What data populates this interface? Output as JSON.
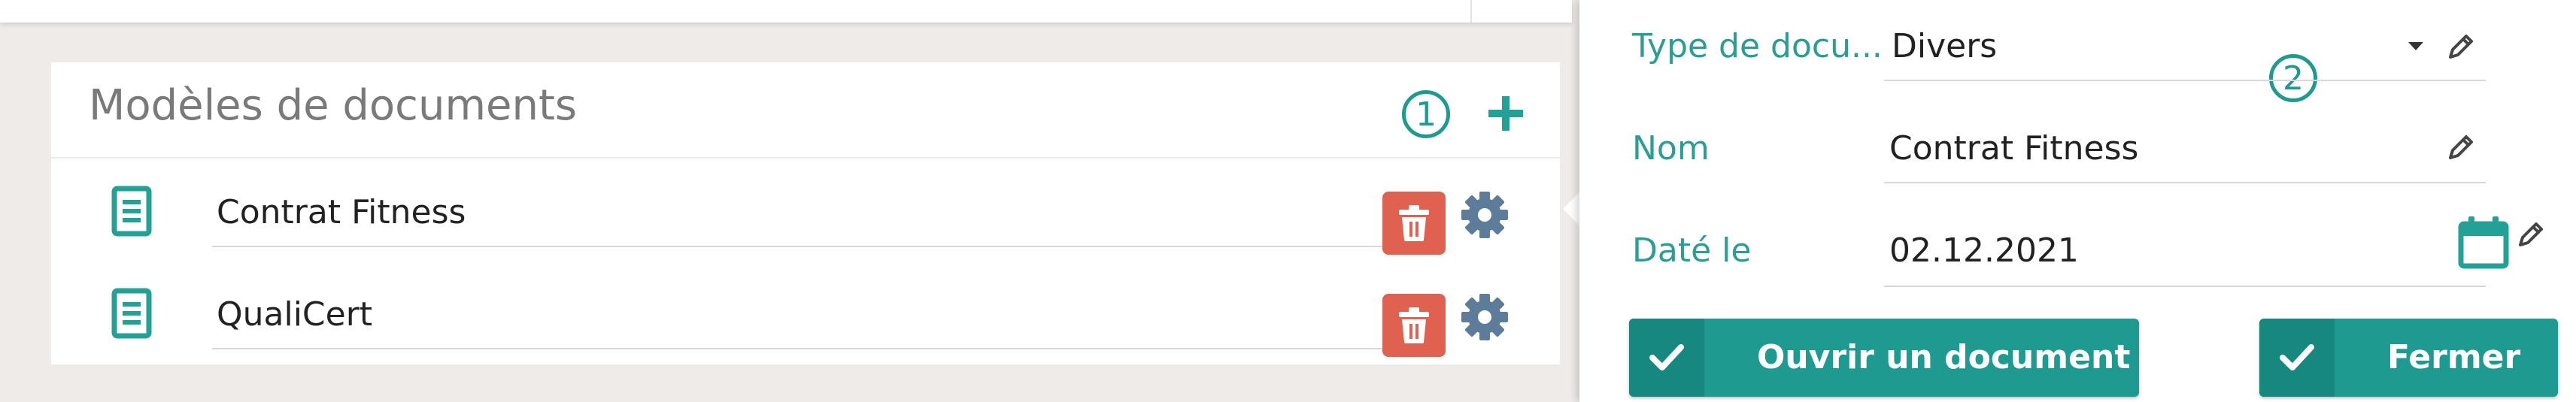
{
  "templates": {
    "title": "Modèles de documents",
    "marker": "1",
    "rows": [
      {
        "label": "Contrat Fitness"
      },
      {
        "label": "QualiCert"
      }
    ]
  },
  "detail": {
    "marker": "2",
    "fields": {
      "type": {
        "label": "Type de docu...",
        "value": "Divers"
      },
      "name": {
        "label": "Nom",
        "value": "Contrat Fitness"
      },
      "date": {
        "label": "Daté le",
        "value": "02.12.2021"
      }
    },
    "buttons": {
      "open": "Ouvrir un document",
      "close": "Fermer"
    }
  },
  "icons": {
    "document": "document-icon",
    "delete": "trash-icon",
    "settings": "gear-icon",
    "add": "plus-icon",
    "edit": "pencil-icon",
    "calendar": "calendar-icon",
    "confirm": "checkmark-icon"
  },
  "colors": {
    "accent": "#1e9a91",
    "danger": "#e06150",
    "gear": "#5c7c99",
    "background": "#efebe9"
  }
}
